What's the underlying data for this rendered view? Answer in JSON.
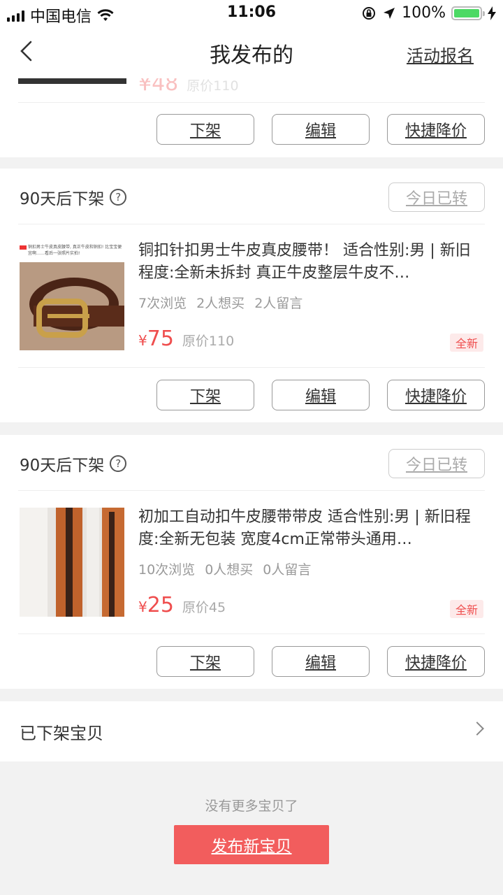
{
  "status_bar": {
    "carrier": "中国电信",
    "time": "11:06",
    "battery": "100%"
  },
  "nav": {
    "title": "我发布的",
    "action": "活动报名"
  },
  "top_partial": {
    "price": "¥48",
    "orig": "原价110"
  },
  "buttons": {
    "delist": "下架",
    "edit": "编辑",
    "quick_discount": "快捷降价"
  },
  "items": [
    {
      "expiry": "90天后下架",
      "shared_label": "今日已转",
      "title": "铜扣针扣男士牛皮真皮腰带！ 适合性别:男 | 新旧程度:全新未拆封 真正牛皮整层牛皮不…",
      "views": "7次浏览",
      "wants": "2人想买",
      "comments": "2人留言",
      "currency": "¥",
      "price": "75",
      "orig": "原价110",
      "badge": "全新",
      "thumb_caption": "铜扣男士牛皮真皮腰带,  真正牛皮和铜扣! 比宝宝便宜啊……看后一张照片实拍!"
    },
    {
      "expiry": "90天后下架",
      "shared_label": "今日已转",
      "title": "初加工自动扣牛皮腰带带皮 适合性别:男 | 新旧程度:全新无包装 宽度4cm正常带头通用…",
      "views": "10次浏览",
      "wants": "0人想买",
      "comments": "0人留言",
      "currency": "¥",
      "price": "25",
      "orig": "原价45",
      "badge": "全新"
    }
  ],
  "delisted": {
    "label": "已下架宝贝"
  },
  "footer": {
    "no_more": "没有更多宝贝了",
    "publish": "发布新宝贝"
  },
  "colors": {
    "accent": "#f25d5d",
    "price": "#ef4e4e"
  }
}
